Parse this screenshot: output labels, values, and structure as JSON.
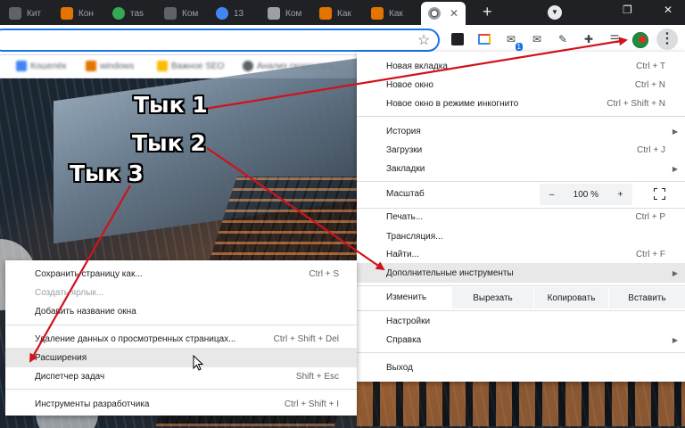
{
  "tabs": [
    {
      "label": "Кит",
      "color": "#5f6368"
    },
    {
      "label": "Кон",
      "color": "#e37400"
    },
    {
      "label": "таs",
      "color": "#34a853"
    },
    {
      "label": "Ком",
      "color": "#5f6368"
    },
    {
      "label": "13",
      "color": "#4285f4"
    },
    {
      "label": "Ком",
      "color": "#9aa0a6"
    },
    {
      "label": "Как",
      "color": "#e37400"
    },
    {
      "label": "Как",
      "color": "#e37400"
    }
  ],
  "bookmarks": [
    {
      "label": "Кошелёк",
      "color": "#4285f4"
    },
    {
      "label": "windows",
      "color": "#e37400"
    },
    {
      "label": "Важное SEO",
      "color": "#fbbc04"
    },
    {
      "label": "Анализ скорости с...",
      "color": "#5f6368"
    }
  ],
  "extensions": {
    "mail_badge": "1"
  },
  "menu": {
    "new_tab": "Новая вкладка",
    "new_tab_sc": "Ctrl + T",
    "new_window": "Новое окно",
    "new_window_sc": "Ctrl + N",
    "incognito": "Новое окно в режиме инкогнито",
    "incognito_sc": "Ctrl + Shift + N",
    "history": "История",
    "downloads": "Загрузки",
    "downloads_sc": "Ctrl + J",
    "bookmarks": "Закладки",
    "zoom_label": "Масштаб",
    "zoom_minus": "–",
    "zoom_value": "100 %",
    "zoom_plus": "+",
    "print": "Печать...",
    "print_sc": "Ctrl + P",
    "cast": "Трансляция...",
    "find": "Найти...",
    "find_sc": "Ctrl + F",
    "more_tools": "Дополнительные инструменты",
    "edit_label": "Изменить",
    "cut": "Вырезать",
    "copy": "Копировать",
    "paste": "Вставить",
    "settings": "Настройки",
    "help": "Справка",
    "exit": "Выход"
  },
  "submenu": {
    "save_page": "Сохранить страницу как...",
    "save_page_sc": "Ctrl + S",
    "create_shortcut": "Создать ярлык...",
    "name_window": "Добавить название окна",
    "clear_data": "Удаление данных о просмотренных страницах...",
    "clear_data_sc": "Ctrl + Shift + Del",
    "extensions": "Расширения",
    "task_manager": "Диспетчер задач",
    "task_manager_sc": "Shift + Esc",
    "dev_tools": "Инструменты разработчика",
    "dev_tools_sc": "Ctrl + Shift + I"
  },
  "annotations": {
    "step1": "Тык 1",
    "step2": "Тык 2",
    "step3": "Тык 3"
  },
  "colors": {
    "arrow": "#d0121b",
    "accent": "#1a73e8",
    "highlight": "#e8e8e8"
  }
}
